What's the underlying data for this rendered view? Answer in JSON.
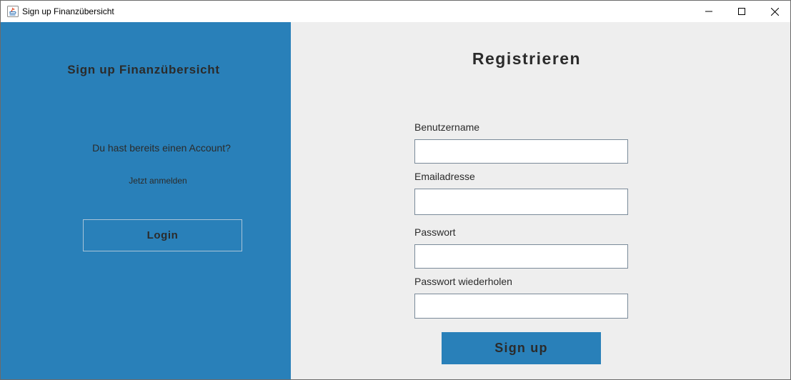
{
  "window": {
    "title": "Sign up Finanzübersicht",
    "icon": "java-icon",
    "controls": [
      "minimize-icon",
      "maximize-icon",
      "close-icon"
    ]
  },
  "left_panel": {
    "title": "Sign up Finanzübersicht",
    "question": "Du hast bereits einen Account?",
    "hint": "Jetzt anmelden",
    "login_label": "Login"
  },
  "right_panel": {
    "title": "Registrieren",
    "fields": [
      {
        "label": "Benutzername",
        "value": ""
      },
      {
        "label": "Emailadresse",
        "value": ""
      },
      {
        "label": "Passwort",
        "value": ""
      },
      {
        "label": "Passwort wiederholen",
        "value": ""
      }
    ],
    "signup_label": "Sign up"
  },
  "colors": {
    "panel_blue": "#2980b9",
    "panel_gray": "#eeeeee",
    "text_dark": "#2b2b2b"
  }
}
